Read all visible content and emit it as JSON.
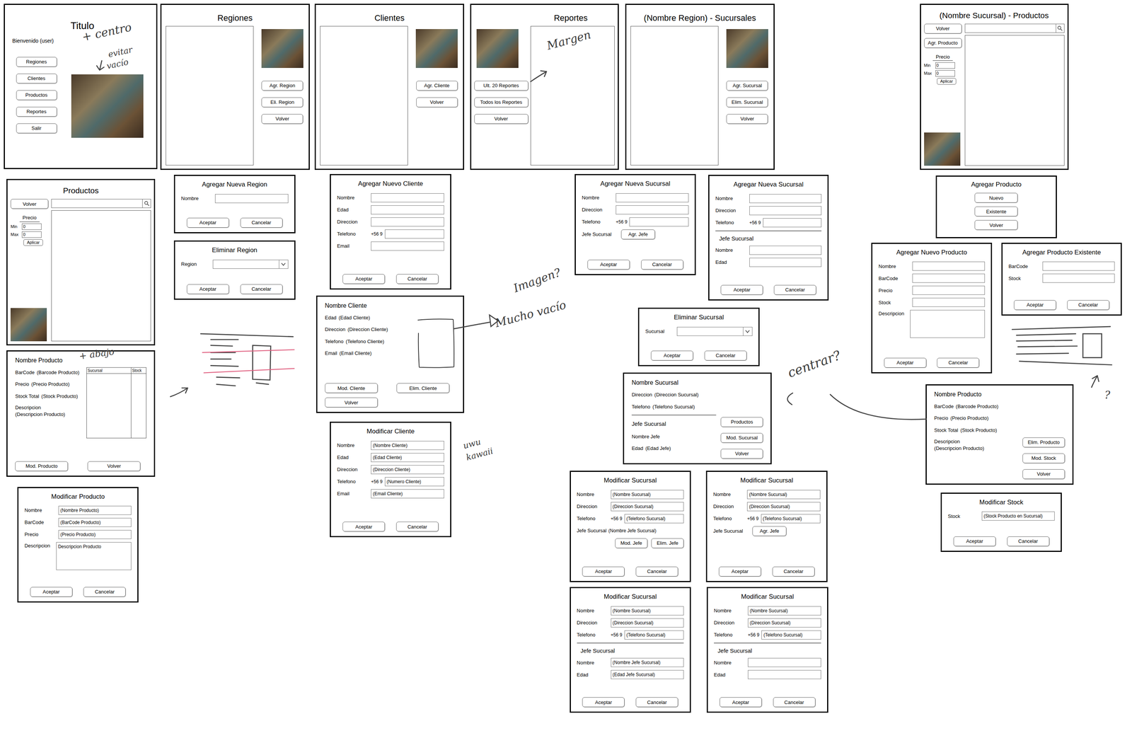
{
  "panels": [
    {
      "kind": "menu",
      "title": "Titulo",
      "greeting": "Bienvenido (user)",
      "buttons": [
        "Regiones",
        "Clientes",
        "Productos",
        "Reportes",
        "Salir"
      ]
    },
    {
      "kind": "list-right",
      "title": "Regiones",
      "buttons": [
        "Agr. Region",
        "Eli. Region",
        "Volver"
      ]
    },
    {
      "kind": "list-right",
      "title": "Clientes",
      "buttons": [
        "Agr. Cliente",
        "Volver"
      ]
    },
    {
      "kind": "list-left",
      "title": "Reportes",
      "buttons": [
        "Ult. 20 Reportes",
        "Todos los Reportes",
        "Volver"
      ]
    },
    {
      "kind": "list-right",
      "title": "(Nombre Region) - Sucursales",
      "buttons": [
        "Agr. Sucursal",
        "Elim. Sucursal",
        "Volver"
      ]
    },
    {
      "kind": "filter",
      "title": "(Nombre Sucursal) - Productos",
      "buttons": [
        "Volver",
        "Agr. Producto"
      ],
      "search": "",
      "filter": {
        "label": "Precio",
        "min_label": "Min",
        "min": "0",
        "max_label": "Max",
        "max": "0",
        "apply": "Aplicar"
      }
    },
    {
      "kind": "filter",
      "title": "Productos",
      "buttons": [
        "Volver"
      ],
      "search": "",
      "filter": {
        "label": "Precio",
        "min_label": "Min",
        "min": "0",
        "max_label": "Max",
        "max": "0",
        "apply": "Aplicar"
      }
    },
    {
      "kind": "form",
      "title": "Agregar Nueva Region",
      "rows": [
        {
          "kind": "field",
          "label": "Nombre",
          "value": ""
        }
      ],
      "buttons": [
        "Aceptar",
        "Cancelar"
      ]
    },
    {
      "kind": "form",
      "title": "Eliminar Region",
      "rows": [
        {
          "kind": "select",
          "label": "Region",
          "value": ""
        }
      ],
      "buttons": [
        "Aceptar",
        "Cancelar"
      ]
    },
    {
      "kind": "form",
      "title": "Agregar Nuevo Cliente",
      "rows": [
        {
          "kind": "field",
          "label": "Nombre",
          "value": ""
        },
        {
          "kind": "field",
          "label": "Edad",
          "value": ""
        },
        {
          "kind": "field",
          "label": "Direccion",
          "value": ""
        },
        {
          "kind": "field",
          "label": "Telefono",
          "prefix": "+56 9",
          "value": ""
        },
        {
          "kind": "field",
          "label": "Email",
          "value": ""
        }
      ],
      "buttons": [
        "Aceptar",
        "Cancelar"
      ]
    },
    {
      "kind": "detail",
      "title": "Nombre Cliente",
      "items": [
        {
          "kind": "text",
          "label": "Edad",
          "value": "(Edad Cliente)"
        },
        {
          "kind": "text",
          "label": "Direccion",
          "value": "(Direccion Cliente)"
        },
        {
          "kind": "text",
          "label": "Telefono",
          "value": "(Telefono Cliente)"
        },
        {
          "kind": "text",
          "label": "Email",
          "value": "(Email Cliente)"
        }
      ],
      "side": {
        "kind": "sketch"
      },
      "buttons": [
        "Mod. Cliente",
        "Elim. Cliente",
        "Volver"
      ]
    },
    {
      "kind": "form",
      "title": "Modificar Cliente",
      "rows": [
        {
          "kind": "field",
          "label": "Nombre",
          "value": "(Nombre Cliente)"
        },
        {
          "kind": "field",
          "label": "Edad",
          "value": "(Edad Cliente)"
        },
        {
          "kind": "field",
          "label": "Direccion",
          "value": "(Direccion Cliente)"
        },
        {
          "kind": "field",
          "label": "Telefono",
          "prefix": "+56 9",
          "value": "(Numero Cliente)"
        },
        {
          "kind": "field",
          "label": "Email",
          "value": "(Email Cliente)"
        }
      ],
      "buttons": [
        "Aceptar",
        "Cancelar"
      ]
    },
    {
      "kind": "detail",
      "title": "Nombre Producto",
      "items": [
        {
          "kind": "text",
          "label": "BarCode",
          "value": "(Barcode Producto)"
        },
        {
          "kind": "text",
          "label": "Precio",
          "value": "(Precio Producto)"
        },
        {
          "kind": "text",
          "label": "Stock Total",
          "value": "(Stock Producto)"
        },
        {
          "kind": "stacked",
          "label": "Descripcion",
          "value": "(Descripcion Producto)"
        }
      ],
      "side": {
        "kind": "table",
        "columns": [
          "Sucursal",
          "Stock"
        ]
      },
      "buttons": [
        "Mod. Producto",
        "Volver"
      ]
    },
    {
      "kind": "form",
      "title": "Modificar Producto",
      "rows": [
        {
          "kind": "field",
          "label": "Nombre",
          "value": "(Nombre Producto)"
        },
        {
          "kind": "field",
          "label": "BarCode",
          "value": "(BarCode Producto)"
        },
        {
          "kind": "field",
          "label": "Precio",
          "value": "(Precio Producto)"
        },
        {
          "kind": "textarea",
          "label": "Descripcion",
          "value": "Descripcion Producto"
        }
      ],
      "buttons": [
        "Aceptar",
        "Cancelar"
      ]
    },
    {
      "kind": "form",
      "title": "Agregar Nueva Sucursal",
      "rows": [
        {
          "kind": "field",
          "label": "Nombre",
          "value": ""
        },
        {
          "kind": "field",
          "label": "Direccion",
          "value": ""
        },
        {
          "kind": "field",
          "label": "Telefono",
          "prefix": "+56 9",
          "value": ""
        },
        {
          "kind": "action",
          "label": "Jefe Sucursal",
          "button": "Agr. Jefe"
        }
      ],
      "buttons": [
        "Aceptar",
        "Cancelar"
      ]
    },
    {
      "kind": "form",
      "title": "Agregar Nueva Sucursal",
      "rows": [
        {
          "kind": "field",
          "label": "Nombre",
          "value": ""
        },
        {
          "kind": "field",
          "label": "Direccion",
          "value": ""
        },
        {
          "kind": "field",
          "label": "Telefono",
          "prefix": "+56 9",
          "value": ""
        },
        {
          "kind": "divider"
        },
        {
          "kind": "heading",
          "text": "Jefe Sucursal"
        },
        {
          "kind": "field",
          "label": "Nombre",
          "value": ""
        },
        {
          "kind": "field",
          "label": "Edad",
          "value": ""
        }
      ],
      "buttons": [
        "Aceptar",
        "Cancelar"
      ]
    },
    {
      "kind": "form",
      "title": "Eliminar Sucursal",
      "rows": [
        {
          "kind": "select",
          "label": "Sucursal",
          "value": ""
        }
      ],
      "buttons": [
        "Aceptar",
        "Cancelar"
      ]
    },
    {
      "kind": "detail",
      "title": "Nombre Sucursal",
      "items": [
        {
          "kind": "text",
          "label": "Direccion",
          "value": "(Direccion Sucursal)"
        },
        {
          "kind": "text",
          "label": "Telefono",
          "value": "(Telefono Sucursal)"
        },
        {
          "kind": "divider"
        },
        {
          "kind": "heading",
          "text": "Jefe Sucursal"
        },
        {
          "kind": "text",
          "label": "Nombre Jefe",
          "value": ""
        },
        {
          "kind": "text",
          "label": "Edad",
          "value": "(Edad Jefe)"
        }
      ],
      "side": {
        "kind": "buttons",
        "buttons": [
          "Productos",
          "Mod. Sucursal",
          "Volver"
        ]
      },
      "buttons": []
    },
    {
      "kind": "form",
      "title": "Modificar Sucursal",
      "rows": [
        {
          "kind": "field",
          "label": "Nombre",
          "value": "(Nombre Sucursal)"
        },
        {
          "kind": "field",
          "label": "Direccion",
          "value": "(Direccion Sucursal)"
        },
        {
          "kind": "field",
          "label": "Telefono",
          "prefix": "+56 9",
          "value": "(Telefono Sucursal)"
        },
        {
          "kind": "static",
          "label": "Jefe Sucursal",
          "value": "(Nombre Jefe Sucursal)"
        },
        {
          "kind": "buttons",
          "buttons": [
            "Mod. Jefe",
            "Elim. Jefe"
          ]
        }
      ],
      "buttons": [
        "Aceptar",
        "Cancelar"
      ]
    },
    {
      "kind": "form",
      "title": "Modificar Sucursal",
      "rows": [
        {
          "kind": "field",
          "label": "Nombre",
          "value": "(Nombre Sucursal)"
        },
        {
          "kind": "field",
          "label": "Direccion",
          "value": "(Direccion Sucursal)"
        },
        {
          "kind": "field",
          "label": "Telefono",
          "prefix": "+56 9",
          "value": "(Telefono Sucursal)"
        },
        {
          "kind": "action",
          "label": "Jefe Sucursal",
          "button": "Agr. Jefe"
        }
      ],
      "buttons": [
        "Aceptar",
        "Cancelar"
      ]
    },
    {
      "kind": "form",
      "title": "Modificar Sucursal",
      "rows": [
        {
          "kind": "field",
          "label": "Nombre",
          "value": "(Nombre Sucursal)"
        },
        {
          "kind": "field",
          "label": "Direccion",
          "value": "(Direccion Sucursal)"
        },
        {
          "kind": "field",
          "label": "Telefono",
          "prefix": "+56 9",
          "value": "(Telefono Sucursal)"
        },
        {
          "kind": "divider"
        },
        {
          "kind": "heading",
          "text": "Jefe Sucursal"
        },
        {
          "kind": "field",
          "label": "Nombre",
          "value": "(Nombre Jefe Sucursal)"
        },
        {
          "kind": "field",
          "label": "Edad",
          "value": "(Edad Jefe Sucursal)"
        }
      ],
      "buttons": [
        "Aceptar",
        "Cancelar"
      ]
    },
    {
      "kind": "form",
      "title": "Modificar Sucursal",
      "rows": [
        {
          "kind": "field",
          "label": "Nombre",
          "value": "(Nombre Sucursal)"
        },
        {
          "kind": "field",
          "label": "Direccion",
          "value": "(Direccion Sucursal)"
        },
        {
          "kind": "field",
          "label": "Telefono",
          "prefix": "+56 9",
          "value": "(Telefono Sucursal)"
        },
        {
          "kind": "divider"
        },
        {
          "kind": "heading",
          "text": "Jefe Sucursal"
        },
        {
          "kind": "field",
          "label": "Nombre",
          "value": ""
        },
        {
          "kind": "field",
          "label": "Edad",
          "value": ""
        }
      ],
      "buttons": [
        "Aceptar",
        "Cancelar"
      ]
    },
    {
      "kind": "choice",
      "title": "Agregar Producto",
      "buttons": [
        "Nuevo",
        "Existente",
        "Volver"
      ]
    },
    {
      "kind": "form",
      "title": "Agregar Nuevo Producto",
      "rows": [
        {
          "kind": "field",
          "label": "Nombre",
          "value": ""
        },
        {
          "kind": "field",
          "label": "BarCode",
          "value": ""
        },
        {
          "kind": "field",
          "label": "Precio",
          "value": ""
        },
        {
          "kind": "field",
          "label": "Stock",
          "value": ""
        },
        {
          "kind": "textarea",
          "label": "Descripcion",
          "value": ""
        }
      ],
      "buttons": [
        "Aceptar",
        "Cancelar"
      ]
    },
    {
      "kind": "form",
      "title": "Agregar Producto Existente",
      "rows": [
        {
          "kind": "field",
          "label": "BarCode",
          "value": ""
        },
        {
          "kind": "field",
          "label": "Stock",
          "value": ""
        }
      ],
      "buttons": [
        "Aceptar",
        "Cancelar"
      ]
    },
    {
      "kind": "detail",
      "title": "Nombre Producto",
      "items": [
        {
          "kind": "text",
          "label": "BarCode",
          "value": "(Barcode Producto)"
        },
        {
          "kind": "text",
          "label": "Precio",
          "value": "(Precio Producto)"
        },
        {
          "kind": "text",
          "label": "Stock Total",
          "value": "(Stock Producto)"
        },
        {
          "kind": "stacked",
          "label": "Descripcion",
          "value": "(Descripcion Producto)"
        }
      ],
      "side": {
        "kind": "buttons",
        "buttons": [
          "Elim. Producto",
          "Mod. Stock",
          "Volver"
        ]
      },
      "buttons": []
    },
    {
      "kind": "form",
      "title": "Modificar Stock",
      "rows": [
        {
          "kind": "field",
          "label": "Stock",
          "value": "(Stock Producto en Sucursal)"
        }
      ],
      "buttons": [
        "Aceptar",
        "Cancelar"
      ]
    }
  ],
  "annotations": [
    {
      "text": "+ centro"
    },
    {
      "text": "evitar"
    },
    {
      "text": "vacío"
    },
    {
      "text": "Margen"
    },
    {
      "text": "+ abajo"
    },
    {
      "text": "Imagen?"
    },
    {
      "text": "Mucho vacío"
    },
    {
      "text": "uwu"
    },
    {
      "text": "kawaii"
    },
    {
      "text": "centrar?"
    },
    {
      "text": "?"
    }
  ]
}
